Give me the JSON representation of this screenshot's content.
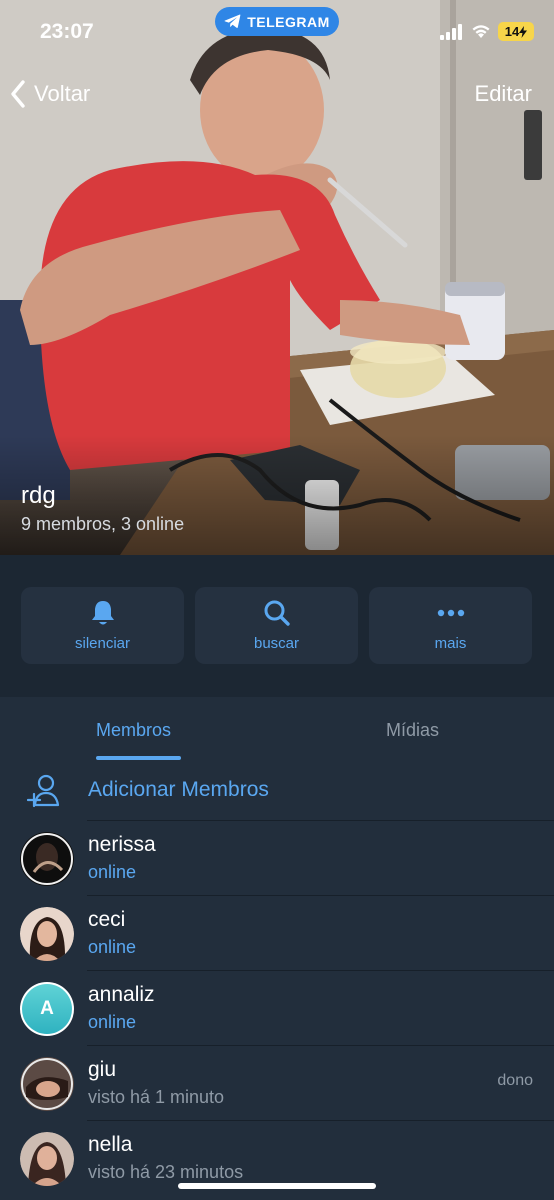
{
  "status_bar": {
    "time": "23:07",
    "pill_label": "TELEGRAM",
    "battery": "14"
  },
  "nav": {
    "back_label": "Voltar",
    "edit_label": "Editar"
  },
  "group": {
    "name": "rdg",
    "subtitle": "9 membros, 3 online"
  },
  "actions": [
    {
      "label": "silenciar",
      "icon": "bell-icon"
    },
    {
      "label": "buscar",
      "icon": "search-icon"
    },
    {
      "label": "mais",
      "icon": "more-icon"
    }
  ],
  "tabs": [
    {
      "label": "Membros",
      "active": true
    },
    {
      "label": "Mídias",
      "active": false
    }
  ],
  "add_members_label": "Adicionar Membros",
  "members": [
    {
      "name": "nerissa",
      "status": "online",
      "role": ""
    },
    {
      "name": "ceci",
      "status": "online",
      "role": ""
    },
    {
      "name": "annaliz",
      "status": "online",
      "role": "",
      "avatar_letter": "A"
    },
    {
      "name": "giu",
      "status": "visto há 1 minuto",
      "role": "dono"
    },
    {
      "name": "nella",
      "status": "visto há 23 minutos",
      "role": ""
    }
  ],
  "colors": {
    "accent": "#5aa7f0",
    "background": "#1c2733",
    "list_background": "#222e3c",
    "telegram_pill": "#2f86e6",
    "battery": "#f7d54a"
  }
}
